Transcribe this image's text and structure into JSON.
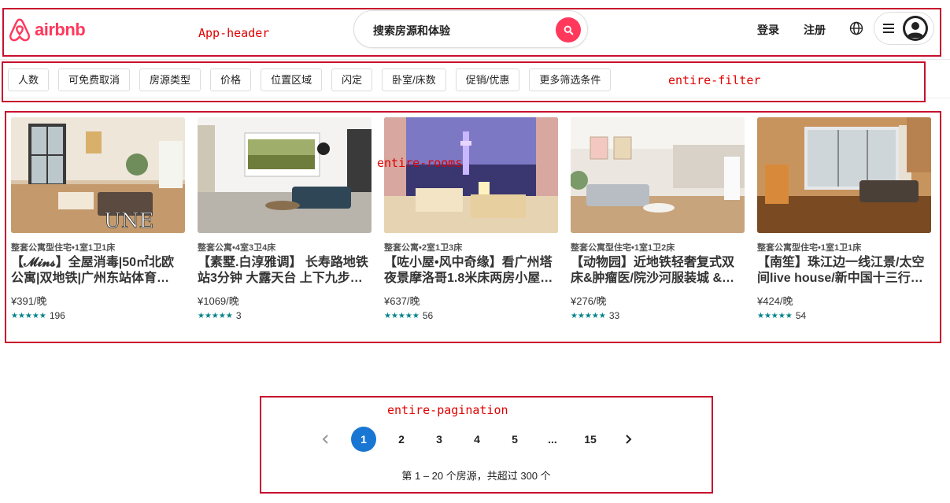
{
  "header": {
    "logo_text": "airbnb",
    "search_text": "搜索房源和体验",
    "login": "登录",
    "register": "注册",
    "annotation": "App-header"
  },
  "filter": {
    "annotation": "entire-filter",
    "items": [
      "人数",
      "可免费取消",
      "房源类型",
      "价格",
      "位置区域",
      "闪定",
      "卧室/床数",
      "促销/优惠",
      "更多筛选条件"
    ]
  },
  "rooms": {
    "annotation": "entire-rooms",
    "items": [
      {
        "type": "整套公寓型住宅•1室1卫1床",
        "name": "【𝓜𝓲𝓷𝓼】全屋消毒|50㎡北欧公寓|双地铁|广州东站体育…",
        "price": "¥391/晚",
        "reviews": "196"
      },
      {
        "type": "整套公寓•4室3卫4床",
        "name": "【素墅.白淳雅调】 长寿路地铁站3分钟 大露天台 上下九步…",
        "price": "¥1069/晚",
        "reviews": "3"
      },
      {
        "type": "整套公寓•2室1卫3床",
        "name": "【咗小屋•风中奇缘】看广州塔夜景摩洛哥1.8米床两房小屋…",
        "price": "¥637/晚",
        "reviews": "56"
      },
      {
        "type": "整套公寓型住宅•1室1卫2床",
        "name": "【动物园】近地铁轻奢复式双床&肿瘤医/院沙河服装城 &…",
        "price": "¥276/晚",
        "reviews": "33"
      },
      {
        "type": "整套公寓型住宅•1室1卫1床",
        "name": "【南笙】珠江边一线江景/太空间live house/新中国十三行…",
        "price": "¥424/晚",
        "reviews": "54"
      }
    ]
  },
  "pagination": {
    "annotation": "entire-pagination",
    "pages": [
      "1",
      "2",
      "3",
      "4",
      "5",
      "...",
      "15"
    ],
    "current": "1",
    "info": "第 1 – 20 个房源，共超过 300 个"
  },
  "colors": {
    "brand": "#ff385c",
    "star": "#008489",
    "active_page": "#1976d2",
    "annotation": "#c8102e"
  }
}
